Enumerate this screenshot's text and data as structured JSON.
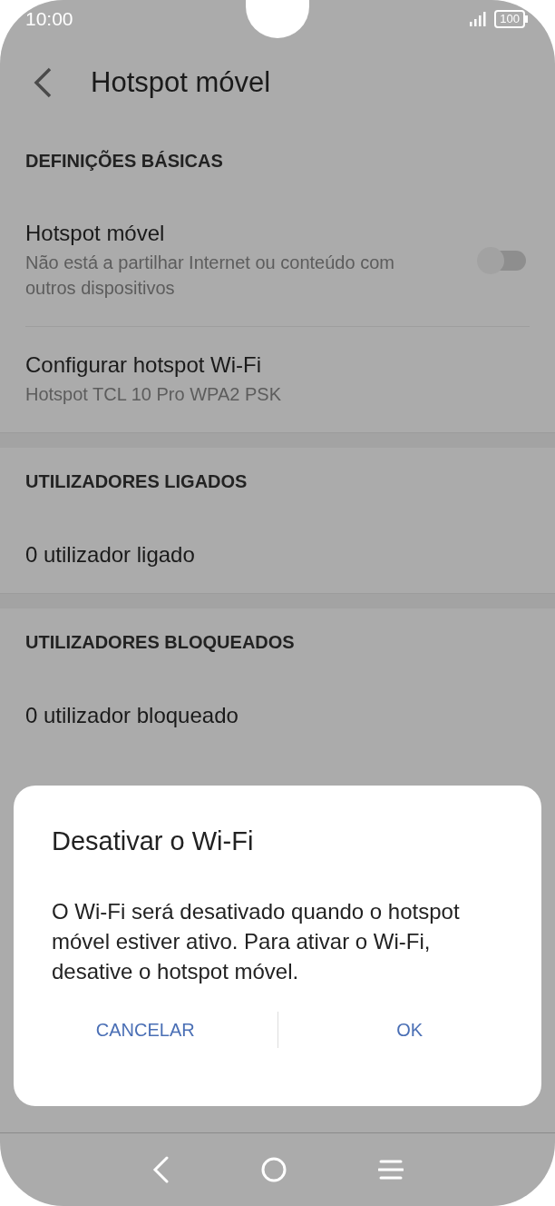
{
  "status_bar": {
    "time": "10:00",
    "battery": "100"
  },
  "header": {
    "title": "Hotspot móvel"
  },
  "sections": [
    {
      "header": "DEFINIÇÕES BÁSICAS",
      "items": [
        {
          "kind": "toggle",
          "title": "Hotspot móvel",
          "subtitle": "Não está a partilhar Internet ou conteúdo com outros dispositivos",
          "on": false
        },
        {
          "kind": "link",
          "title": "Configurar hotspot Wi-Fi",
          "subtitle": "Hotspot TCL 10 Pro WPA2 PSK"
        }
      ]
    },
    {
      "header": "UTILIZADORES LIGADOS",
      "items": [
        {
          "kind": "link",
          "title": "0 utilizador ligado"
        }
      ]
    },
    {
      "header": "UTILIZADORES BLOQUEADOS",
      "items": [
        {
          "kind": "link",
          "title": "0 utilizador bloqueado"
        }
      ]
    }
  ],
  "dialog": {
    "title": "Desativar o Wi-Fi",
    "message": "O Wi-Fi será desativado quando o hotspot móvel estiver ativo. Para ativar o Wi-Fi, desative o hotspot móvel.",
    "buttons": [
      "CANCELAR",
      "OK"
    ]
  }
}
